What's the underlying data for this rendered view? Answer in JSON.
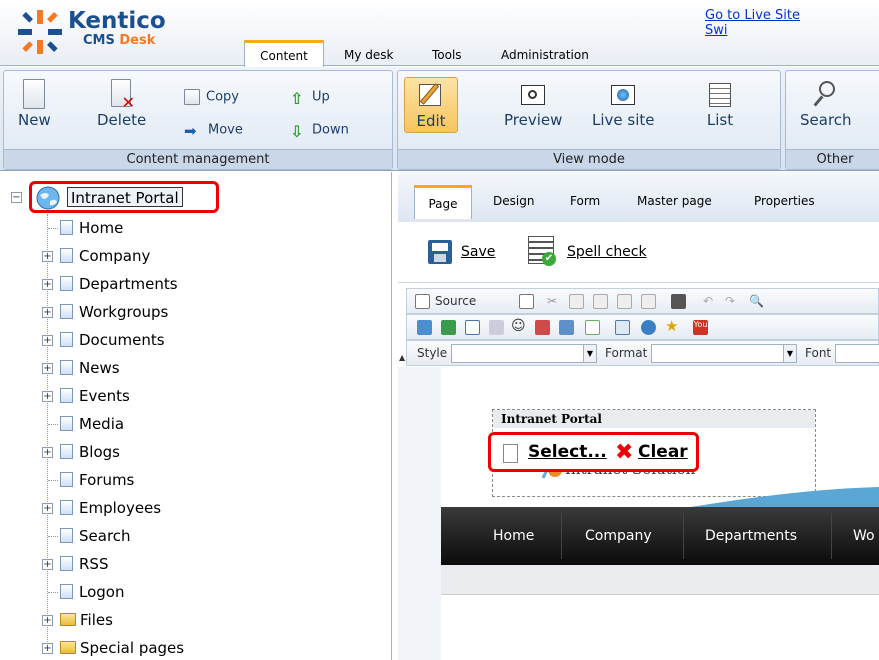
{
  "header": {
    "logo_brand": "Kentico",
    "logo_product_a": "CMS ",
    "logo_product_b": "Desk",
    "links": [
      "Go to Live Site",
      "Swi"
    ],
    "tabs": [
      "Content",
      "My desk",
      "Tools",
      "Administration"
    ],
    "active_tab": "Content"
  },
  "ribbon": {
    "content_management": {
      "title": "Content management",
      "new": "New",
      "delete": "Delete",
      "copy": "Copy",
      "move": "Move",
      "up": "Up",
      "down": "Down"
    },
    "view_mode": {
      "title": "View mode",
      "edit": "Edit",
      "preview": "Preview",
      "live_site": "Live site",
      "list": "List"
    },
    "other": {
      "title": "Other",
      "search": "Search"
    }
  },
  "tree": {
    "root": "Intranet Portal",
    "items": [
      {
        "label": "Home",
        "expandable": false,
        "icon": "page-icon"
      },
      {
        "label": "Company",
        "expandable": true,
        "icon": "page-icon"
      },
      {
        "label": "Departments",
        "expandable": true,
        "icon": "page-icon"
      },
      {
        "label": "Workgroups",
        "expandable": true,
        "icon": "page-icon"
      },
      {
        "label": "Documents",
        "expandable": true,
        "icon": "page-icon"
      },
      {
        "label": "News",
        "expandable": true,
        "icon": "page-icon"
      },
      {
        "label": "Events",
        "expandable": true,
        "icon": "page-icon"
      },
      {
        "label": "Media",
        "expandable": false,
        "icon": "page-icon"
      },
      {
        "label": "Blogs",
        "expandable": true,
        "icon": "page-icon"
      },
      {
        "label": "Forums",
        "expandable": false,
        "icon": "page-icon"
      },
      {
        "label": "Employees",
        "expandable": true,
        "icon": "page-icon"
      },
      {
        "label": "Search",
        "expandable": false,
        "icon": "page-icon"
      },
      {
        "label": "RSS",
        "expandable": true,
        "icon": "page-icon"
      },
      {
        "label": "Logon",
        "expandable": false,
        "icon": "page-icon"
      },
      {
        "label": "Files",
        "expandable": true,
        "icon": "folder-icon"
      },
      {
        "label": "Special pages",
        "expandable": true,
        "icon": "folder-icon"
      }
    ]
  },
  "right": {
    "tabs": [
      "Page",
      "Design",
      "Form",
      "Master page",
      "Properties"
    ],
    "active_tab": "Page",
    "actions": {
      "save": "Save",
      "spell_check": "Spell check"
    },
    "editor_toolbar": {
      "source": "Source",
      "style_label": "Style",
      "format_label": "Format",
      "font_label": "Font"
    },
    "webpart": {
      "title": "Intranet Portal",
      "subtitle": "Intranet Solution",
      "select": "Select...",
      "clear": "Clear"
    },
    "nav": [
      "Home",
      "Company",
      "Departments",
      "Wo"
    ]
  }
}
